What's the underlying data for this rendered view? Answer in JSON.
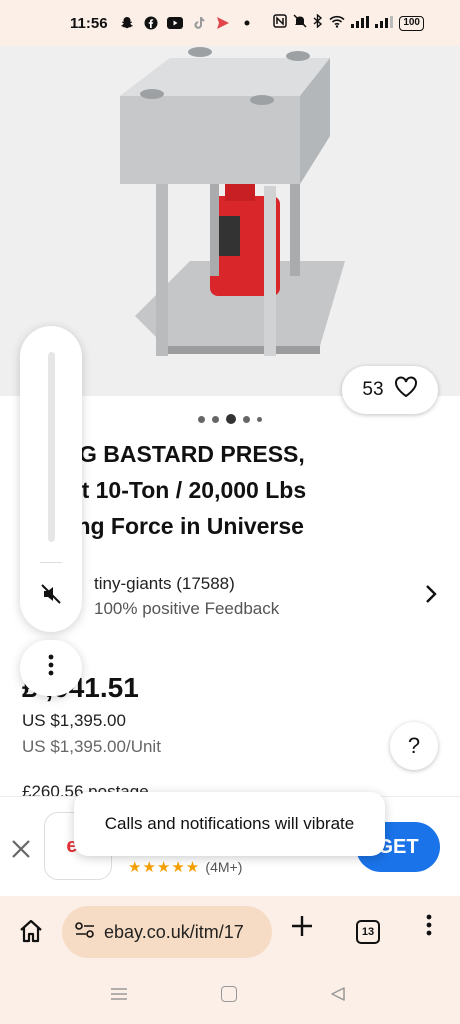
{
  "status_bar": {
    "time": "11:56",
    "icons": [
      "snapchat-icon",
      "facebook-icon",
      "youtube-icon",
      "tiktok-icon",
      "send-icon",
      "dot-icon",
      "nfc-icon",
      "mute-icon",
      "bluetooth-icon",
      "wifi-icon",
      "signal-icon",
      "signal-icon"
    ],
    "battery": "100"
  },
  "product": {
    "likes": "53",
    "carousel": {
      "count": 5,
      "active_index": 2
    },
    "title_lines": [
      "BIG BASTARD PRESS,",
      "est 10-Ton / 20,000 Lbs",
      "hing Force in Universe"
    ]
  },
  "seller": {
    "name": "tiny-giants (17588)",
    "feedback": "100% positive Feedback"
  },
  "pricing": {
    "price": "£ ,041.51",
    "usd": "US $1,395.00",
    "usd_unit": "US $1,395.00/Unit",
    "postage": "£260.56 postage"
  },
  "help": {
    "label": "?"
  },
  "app_banner": {
    "app_icon_text": "eb",
    "rating_stars": "★★★★★",
    "rating_count": "(4M+)",
    "get_label": "GET"
  },
  "toast": {
    "text": "Calls and notifications will vibrate"
  },
  "browser": {
    "url": "ebay.co.uk/itm/17",
    "tab_count": "13"
  },
  "colors": {
    "browser_bg": "#fbefe7",
    "url_pill_bg": "#f7dcc5",
    "get_button": "#1a73e8",
    "rating_star": "#f4a000"
  }
}
